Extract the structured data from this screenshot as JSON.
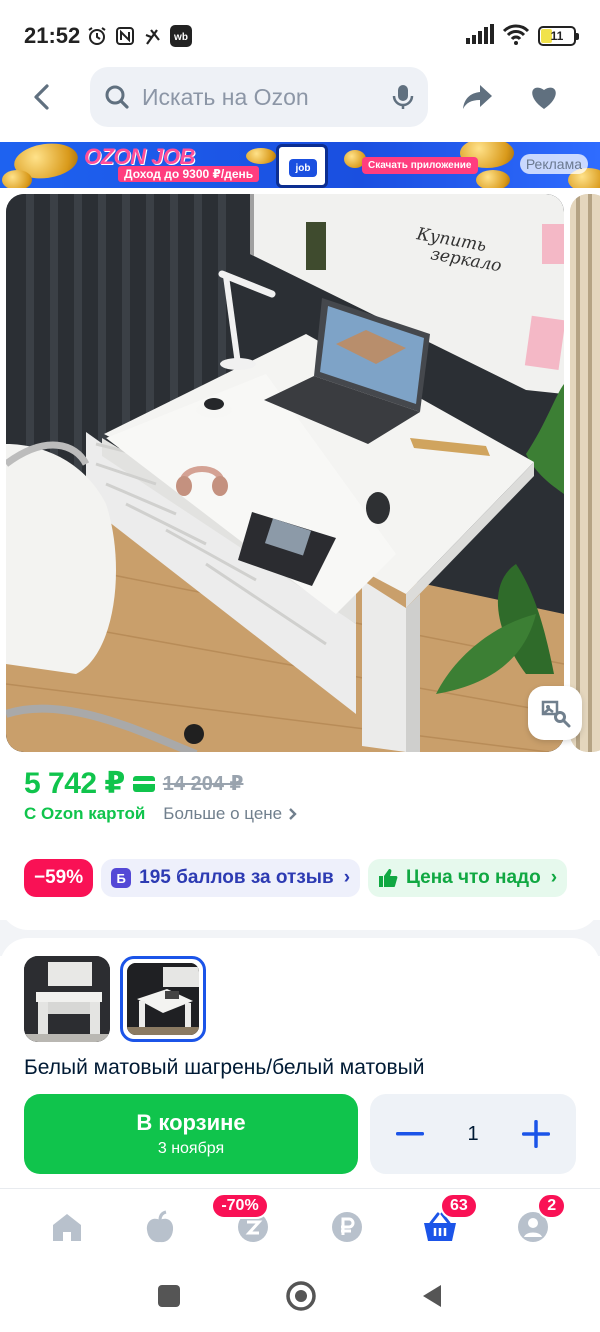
{
  "status_bar": {
    "time": "21:52",
    "battery": "11",
    "icons": [
      "alarm-icon",
      "nfc-icon",
      "app-notification-icon",
      "wb-icon",
      "signal-icon",
      "wifi-icon",
      "battery-icon"
    ]
  },
  "search": {
    "placeholder": "Искать на Ozon",
    "icons": [
      "back-icon",
      "search-icon",
      "microphone-icon",
      "share-icon",
      "heart-icon"
    ]
  },
  "promo": {
    "title": "OZON JOB",
    "subtitle": "Доход до 9300 ₽/день",
    "phone_label": "job",
    "cta": "Скачать приложение",
    "ad_label": "Реклама"
  },
  "gallery": {
    "note_text_1": "Купить",
    "note_text_2": "зеркало",
    "search_icon": "photo-search-icon"
  },
  "price": {
    "current": "5 742 ₽",
    "old": "14 204 ₽",
    "with_card": "С Ozon картой",
    "more": "Больше о цене"
  },
  "badges": {
    "discount": "−59%",
    "points_icon": "Б",
    "points": "195 баллов за отзыв",
    "fair_price": "Цена что надо"
  },
  "variants": {
    "selected_index": 1,
    "name": "Белый матовый шагрень/белый матовый"
  },
  "cart": {
    "label": "В корзине",
    "delivery": "3 ноября",
    "quantity": "1"
  },
  "bottom_nav": {
    "items": [
      {
        "icon": "home-icon",
        "badge": ""
      },
      {
        "icon": "fresh-icon",
        "badge": ""
      },
      {
        "icon": "discounts-icon",
        "badge": "-70%"
      },
      {
        "icon": "finance-icon",
        "badge": ""
      },
      {
        "icon": "cart-icon",
        "badge": "63"
      },
      {
        "icon": "profile-icon",
        "badge": "2"
      }
    ],
    "colors": {
      "active": "#1b54e8",
      "inactive": "#b8c1cc",
      "badge": "#f91155"
    }
  },
  "colors": {
    "green": "#10c44c",
    "blue": "#1b54e8",
    "pink": "#f91155"
  }
}
